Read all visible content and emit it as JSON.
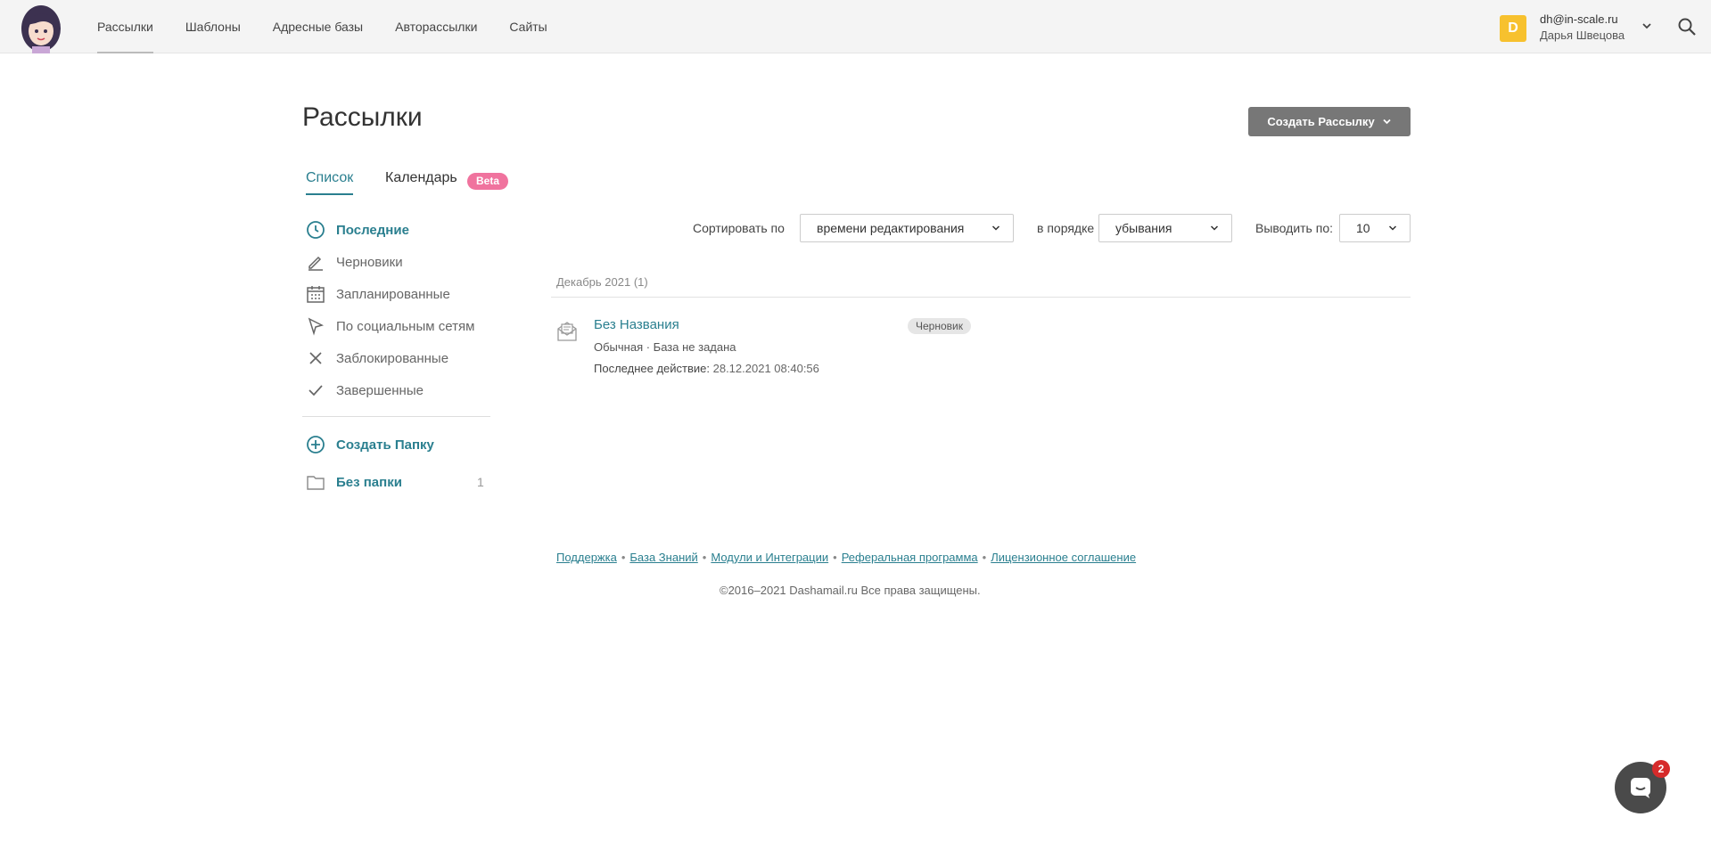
{
  "header": {
    "nav": [
      {
        "label": "Рассылки"
      },
      {
        "label": "Шаблоны"
      },
      {
        "label": "Адресные базы"
      },
      {
        "label": "Авторассылки"
      },
      {
        "label": "Сайты"
      }
    ],
    "user": {
      "initial": "D",
      "email": "dh@in-scale.ru",
      "name": "Дарья Швецова"
    }
  },
  "page": {
    "title": "Рассылки",
    "create_button": "Создать Рассылку"
  },
  "tabs": {
    "list": "Список",
    "calendar": "Календарь",
    "beta": "Beta"
  },
  "sidebar": {
    "items": [
      {
        "label": "Последние",
        "icon": "clock-icon"
      },
      {
        "label": "Черновики",
        "icon": "pencil-icon"
      },
      {
        "label": "Запланированные",
        "icon": "calendar-icon"
      },
      {
        "label": "По социальным сетям",
        "icon": "cursor-icon"
      },
      {
        "label": "Заблокированные",
        "icon": "cross-icon"
      },
      {
        "label": "Завершенные",
        "icon": "check-icon"
      }
    ],
    "create_folder": "Создать Папку",
    "folder": {
      "label": "Без папки",
      "count": "1"
    }
  },
  "sorting": {
    "sort_label": "Сортировать по",
    "sort_value": "времени редактирования",
    "order_label": "в порядке",
    "order_value": "убывания",
    "per_page_label": "Выводить по:",
    "per_page_value": "10"
  },
  "list": {
    "group": "Декабрь 2021 (1)",
    "items": [
      {
        "title": "Без Названия",
        "meta": "Обычная · База не задана",
        "last_label": "Последнее действие:",
        "last_value": "28.12.2021 08:40:56",
        "status": "Черновик"
      }
    ]
  },
  "footer": {
    "links": [
      "Поддержка",
      "База Знаний",
      "Модули и Интеграции",
      "Реферальная программа",
      "Лицензионное соглашение"
    ],
    "copyright": "©2016–2021 Dashamail.ru Все права защищены."
  },
  "chat": {
    "badge": "2"
  },
  "colors": {
    "accent": "#2a7f8f",
    "beta": "#f0739e",
    "avatar": "#f7c12e",
    "button": "#777777",
    "chat": "#4a4a4a",
    "badge": "#d62b2b"
  }
}
